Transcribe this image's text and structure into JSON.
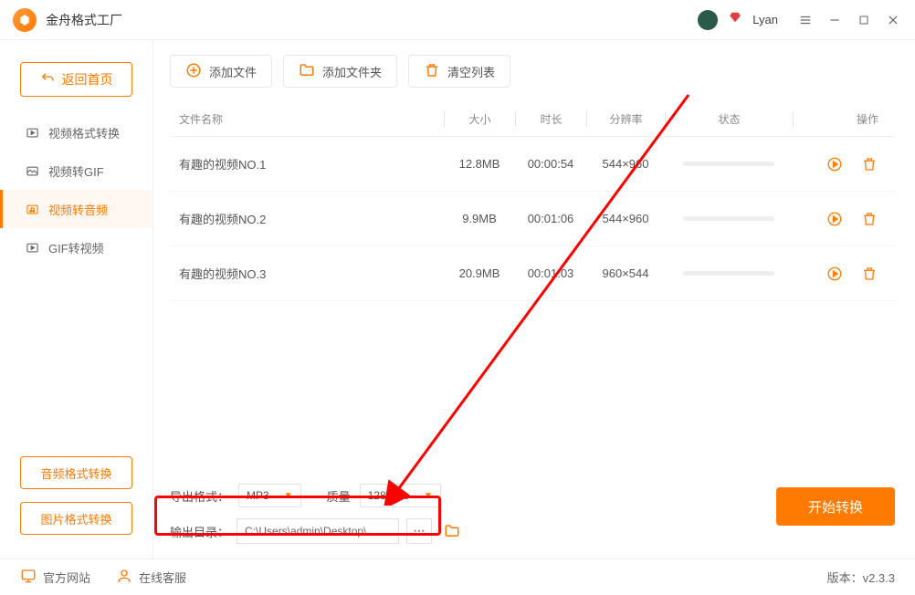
{
  "titlebar": {
    "app_name": "金舟格式工厂",
    "username": "Lyan"
  },
  "sidebar": {
    "back_label": "返回首页",
    "items": [
      {
        "label": "视频格式转换"
      },
      {
        "label": "视频转GIF"
      },
      {
        "label": "视频转音频"
      },
      {
        "label": "GIF转视频"
      }
    ],
    "audio_btn": "音频格式转换",
    "image_btn": "图片格式转换"
  },
  "toolbar": {
    "add_file": "添加文件",
    "add_folder": "添加文件夹",
    "clear_list": "清空列表"
  },
  "columns": {
    "name": "文件名称",
    "size": "大小",
    "duration": "时长",
    "resolution": "分辨率",
    "status": "状态",
    "action": "操作"
  },
  "rows": [
    {
      "name": "有趣的视频NO.1",
      "size": "12.8MB",
      "duration": "00:00:54",
      "resolution": "544×960"
    },
    {
      "name": "有趣的视频NO.2",
      "size": "9.9MB",
      "duration": "00:01:06",
      "resolution": "544×960"
    },
    {
      "name": "有趣的视频NO.3",
      "size": "20.9MB",
      "duration": "00:01:03",
      "resolution": "960×544"
    }
  ],
  "options": {
    "format_label": "导出格式：",
    "format_value": "MP3",
    "quality_label": "质量",
    "quality_value": "128kbps",
    "outdir_label": "输出目录：",
    "outdir_value": "C:\\Users\\admin\\Desktop\\"
  },
  "start_btn": "开始转换",
  "footer": {
    "site": "官方网站",
    "support": "在线客服",
    "version": "版本：v2.3.3"
  }
}
